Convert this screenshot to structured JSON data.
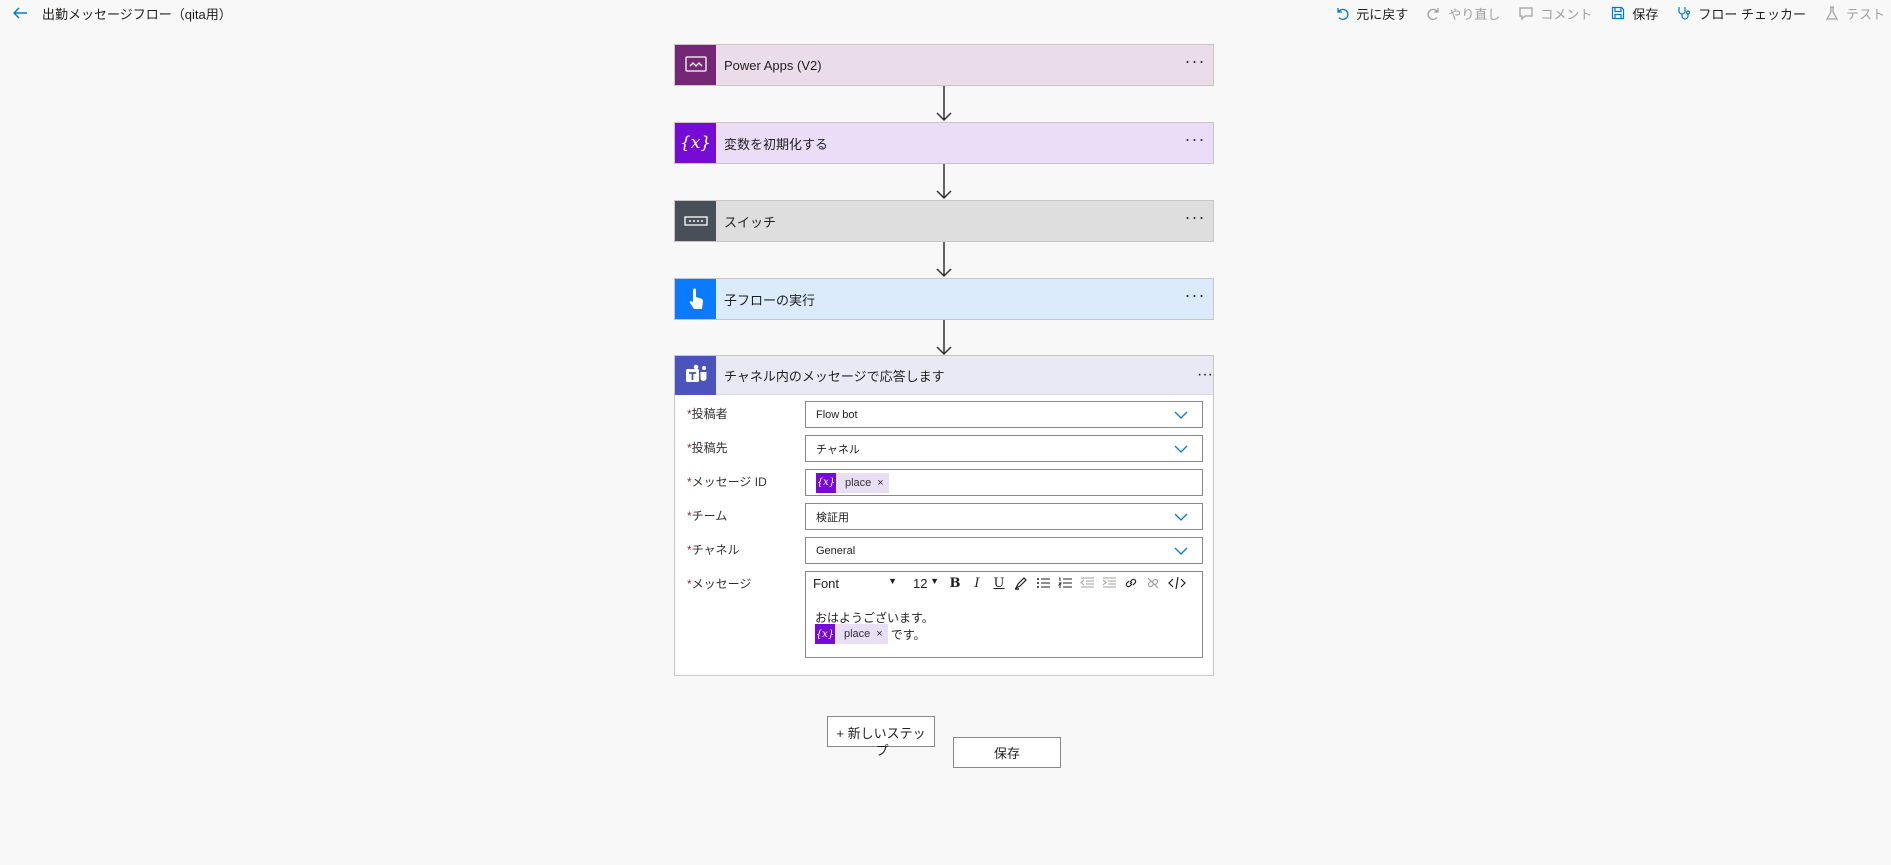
{
  "header": {
    "title": "出勤メッセージフロー（qita用）",
    "commands": [
      {
        "label": "元に戻す",
        "icon": "undo-icon",
        "enabled": true
      },
      {
        "label": "やり直し",
        "icon": "redo-icon",
        "enabled": false
      },
      {
        "label": "コメント",
        "icon": "comment-icon",
        "enabled": false
      },
      {
        "label": "保存",
        "icon": "save-icon",
        "enabled": true
      },
      {
        "label": "フロー チェッカー",
        "icon": "stethoscope-icon",
        "enabled": true
      },
      {
        "label": "テスト",
        "icon": "flask-icon",
        "enabled": false
      }
    ]
  },
  "steps": [
    {
      "title": "Power Apps (V2)",
      "icon": "power-apps-icon",
      "color": "#742774",
      "bg": "#ebdce9"
    },
    {
      "title": "変数を初期化する",
      "icon": "variable-icon",
      "color": "#770bd6",
      "bg": "#ebdcf7"
    },
    {
      "title": "スイッチ",
      "icon": "switch-icon",
      "color": "#484f58",
      "bg": "#dedede"
    },
    {
      "title": "子フローの実行",
      "icon": "hand-pointer-icon",
      "color": "#0a7aff",
      "bg": "#dcebfb"
    }
  ],
  "expanded_step": {
    "title": "チャネル内のメッセージで応答します",
    "icon": "teams-icon",
    "color": "#4b53bc",
    "fields": [
      {
        "label": "投稿者",
        "value": "Flow bot"
      },
      {
        "label": "投稿先",
        "value": "チャネル"
      },
      {
        "label": "メッセージ ID",
        "token": "place"
      },
      {
        "label": "チーム",
        "value": "検証用"
      },
      {
        "label": "チャネル",
        "value": "General"
      }
    ],
    "message": {
      "label": "メッセージ",
      "font": "Font",
      "font_size": "12",
      "line1": "おはようございます。",
      "token": "place",
      "line2_suffix": "です。"
    }
  },
  "required_mark": "*",
  "token_remove": "×",
  "token_symbol": "{x}",
  "dots": "···",
  "buttons": {
    "new_step_line1": "+ 新しいステッ",
    "new_step_line2": "プ",
    "save": "保存"
  }
}
